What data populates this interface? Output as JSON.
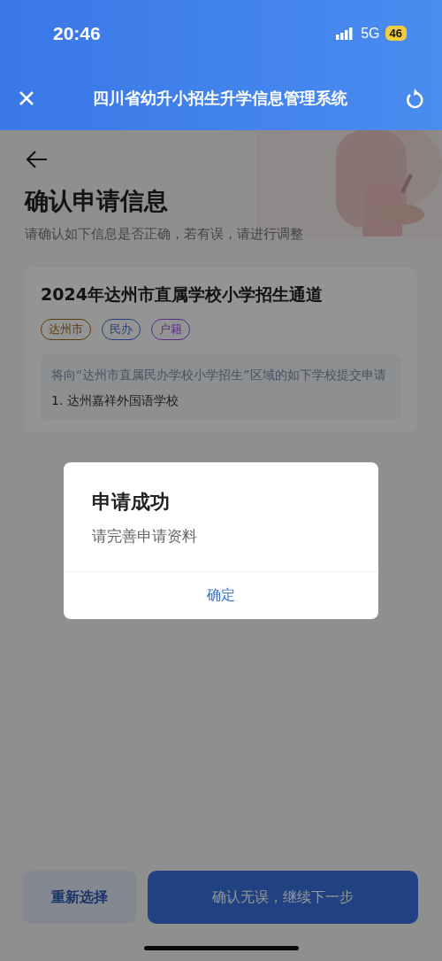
{
  "status_bar": {
    "time": "20:46",
    "network": "5G",
    "battery": "46"
  },
  "header": {
    "title": "四川省幼升小招生升学信息管理系统"
  },
  "page": {
    "title": "确认申请信息",
    "subtitle": "请确认如下信息是否正确，若有误，请进行调整",
    "card": {
      "title": "2024年达州市直属学校小学招生通道",
      "tags": [
        {
          "label": "达州市",
          "color": "#5a3c0c"
        },
        {
          "label": "民办",
          "color": "#26407a"
        },
        {
          "label": "户籍",
          "color": "#5a2a88"
        }
      ],
      "notice": "将向“达州市直属民办学校小学招生”区域的如下学校提交申请",
      "schools": [
        "1. 达州嘉祥外国语学校"
      ]
    }
  },
  "buttons": [
    {
      "label": "重新选择",
      "kind": "secondary"
    },
    {
      "label": "确认无误，继续下一步",
      "kind": "primary"
    }
  ],
  "dialog": {
    "title": "申请成功",
    "message": "请完善申请资料",
    "button": "确定"
  }
}
